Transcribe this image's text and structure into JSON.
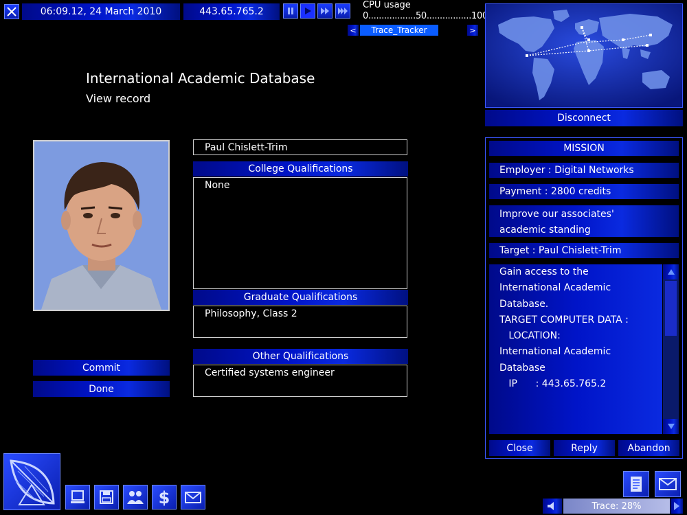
{
  "top_bar": {
    "datetime": "06:09.12, 24 March 2010",
    "ip": "443.65.765.2",
    "cpu_label": "CPU usage",
    "cpu_scale": "0..................50.................100",
    "trace_prev": "<",
    "trace_tracker": "Trace_Tracker",
    "trace_next": ">"
  },
  "map": {
    "disconnect_label": "Disconnect"
  },
  "page": {
    "title": "International Academic Database",
    "subtitle": "View record"
  },
  "record": {
    "name": "Paul Chislett-Trim",
    "college_header": "College Qualifications",
    "college_value": "None",
    "graduate_header": "Graduate Qualifications",
    "graduate_value": "Philosophy, Class 2",
    "other_header": "Other Qualifications",
    "other_value": "Certified systems engineer"
  },
  "actions": {
    "commit": "Commit",
    "done": "Done"
  },
  "mission": {
    "title": "MISSION",
    "employer": "Employer : Digital Networks",
    "payment": "Payment : 2800 credits",
    "desc_line1": "Improve our associates'",
    "desc_line2": "academic standing",
    "target": "Target : Paul Chislett-Trim",
    "details": [
      "Gain access to the",
      "International Academic",
      "Database.",
      "TARGET COMPUTER DATA :",
      "   LOCATION:",
      "International Academic",
      "Database",
      "   IP      : 443.65.765.2"
    ],
    "close": "Close",
    "reply": "Reply",
    "abandon": "Abandon"
  },
  "status": {
    "trace": "Trace: 28%"
  },
  "colors": {
    "accent_blue": "#0014c8",
    "highlight_blue": "#0a5cff",
    "background": "#000000"
  }
}
